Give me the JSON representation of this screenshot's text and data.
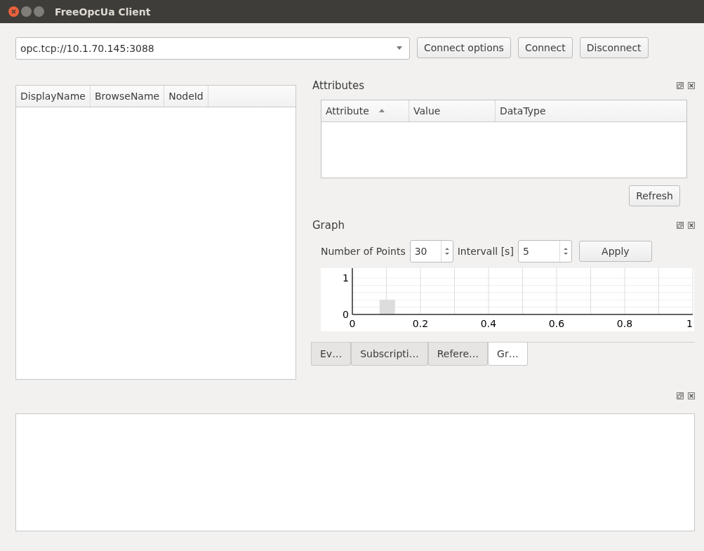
{
  "window": {
    "title": "FreeOpcUa Client"
  },
  "address": {
    "value": "opc.tcp://10.1.70.145:3088"
  },
  "buttons": [
    "Connect options",
    "Connect",
    "Disconnect"
  ],
  "tree": {
    "columns": [
      "DisplayName",
      "BrowseName",
      "NodeId"
    ]
  },
  "attributes": {
    "title": "Attributes",
    "columns": [
      {
        "label": "Attribute",
        "sorted": true
      },
      {
        "label": "Value",
        "sorted": false
      },
      {
        "label": "DataType",
        "sorted": false
      }
    ],
    "refresh": "Refresh"
  },
  "graph": {
    "title": "Graph",
    "points_label": "Number of Points",
    "points": "30",
    "interval_label": "Intervall [s]",
    "interval": "5",
    "apply": "Apply",
    "chart_data": {
      "type": "line",
      "xlim": [
        0,
        1
      ],
      "ylim": [
        0,
        1
      ],
      "xticks": [
        0,
        0.2,
        0.4,
        0.6,
        0.8,
        1
      ],
      "yticks": [
        0,
        1
      ],
      "grid": true
    }
  },
  "tabs": [
    {
      "label": "Ev…",
      "selected": false
    },
    {
      "label": "Subscripti…",
      "selected": false
    },
    {
      "label": "Refere…",
      "selected": false
    },
    {
      "label": "Gr…",
      "selected": true
    }
  ]
}
